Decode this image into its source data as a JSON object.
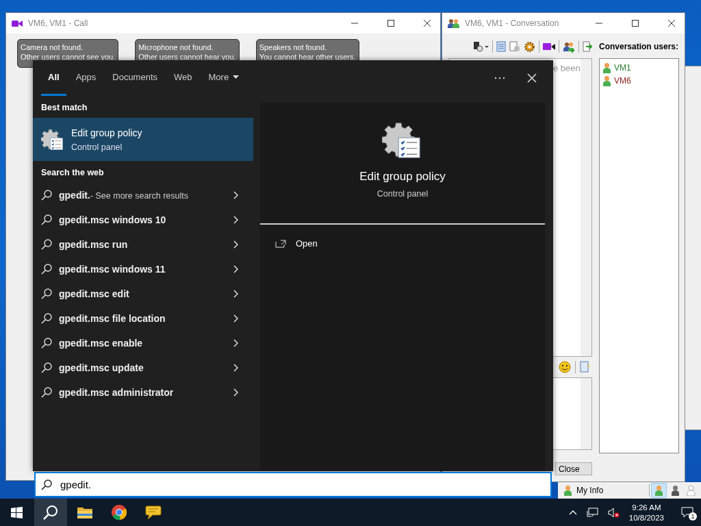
{
  "call_window": {
    "title": "VM6, VM1 - Call",
    "tooltips": [
      {
        "title": "Camera not found.",
        "message": "Other users cannot see you."
      },
      {
        "title": "Microphone not found.",
        "message": "Other users cannot hear you."
      },
      {
        "title": "Speakers not found.",
        "message": "You cannot hear other users."
      }
    ]
  },
  "conversation_window": {
    "title": "VM6, VM1 - Conversation",
    "chat_text": "e been",
    "users_label": "Conversation users:",
    "users": [
      {
        "name": "VM1",
        "color": "#2e7d32"
      },
      {
        "name": "VM6",
        "color": "#8b1a1a"
      }
    ],
    "close_button": "Close"
  },
  "status_bar": {
    "my_info": "My Info",
    "statuses": [
      {
        "kind": "online",
        "selected": true
      },
      {
        "kind": "busy",
        "selected": false
      },
      {
        "kind": "offline",
        "selected": false
      }
    ]
  },
  "search": {
    "tabs": [
      {
        "label": "All",
        "selected": true,
        "dropdown": false
      },
      {
        "label": "Apps",
        "selected": false,
        "dropdown": false
      },
      {
        "label": "Documents",
        "selected": false,
        "dropdown": false
      },
      {
        "label": "Web",
        "selected": false,
        "dropdown": false
      },
      {
        "label": "More",
        "selected": false,
        "dropdown": true
      }
    ],
    "best_match_heading": "Best match",
    "best_match": {
      "title": "Edit group policy",
      "subtitle": "Control panel",
      "selected": true
    },
    "web_heading": "Search the web",
    "results": [
      {
        "text": "gpedit.",
        "hint": "- See more search results"
      },
      {
        "text": "gpedit.msc windows 10"
      },
      {
        "text": "gpedit.msc run"
      },
      {
        "text": "gpedit.msc windows 11"
      },
      {
        "text": "gpedit.msc edit"
      },
      {
        "text": "gpedit.msc file location"
      },
      {
        "text": "gpedit.msc enable"
      },
      {
        "text": "gpedit.msc update"
      },
      {
        "text": "gpedit.msc administrator"
      }
    ],
    "preview": {
      "title": "Edit group policy",
      "subtitle": "Control panel",
      "actions": [
        "Open"
      ]
    },
    "query": "gpedit."
  },
  "taskbar": {
    "apps": [
      {
        "kind": "start",
        "selected": false
      },
      {
        "kind": "search",
        "selected": true
      },
      {
        "kind": "folder",
        "selected": false
      },
      {
        "kind": "browser",
        "selected": false
      },
      {
        "kind": "chat",
        "selected": false
      }
    ],
    "clock": {
      "time": "9:26 AM",
      "date": "10/8/2023"
    },
    "notifications": "1"
  }
}
